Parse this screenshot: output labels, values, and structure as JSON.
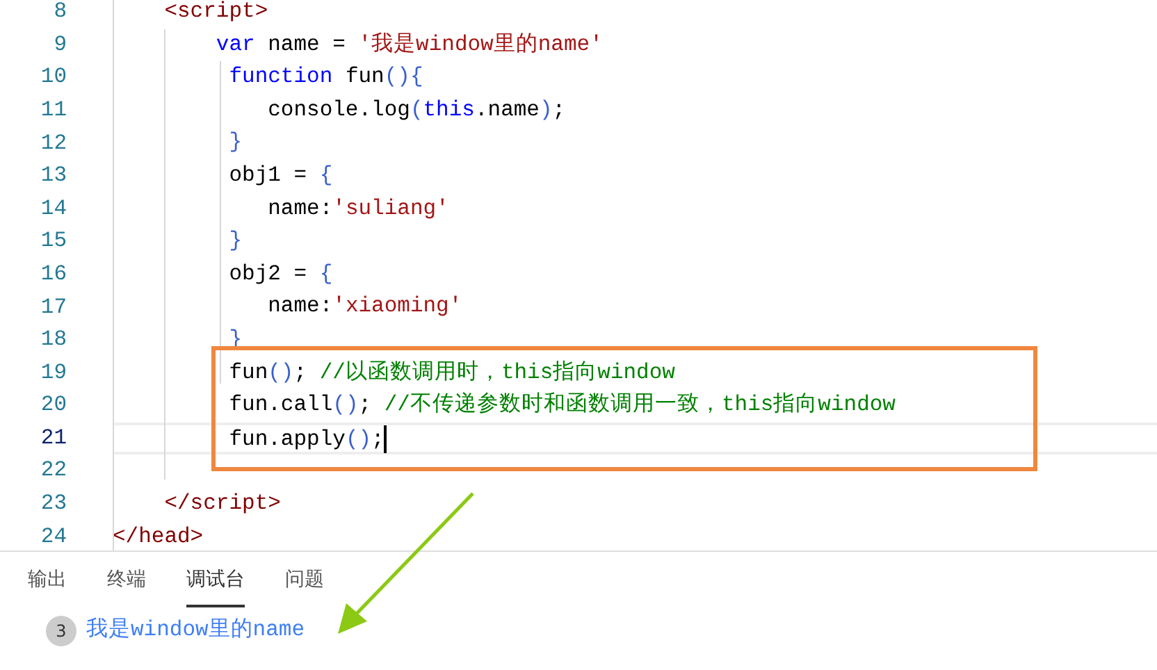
{
  "editor": {
    "lines": [
      {
        "number": "8",
        "current": false,
        "boxed": false,
        "tokens": [
          {
            "kind": "tag",
            "text": "    <script>"
          }
        ]
      },
      {
        "number": "9",
        "current": false,
        "boxed": false,
        "tokens": [
          {
            "kind": "keyword",
            "text": "        var"
          },
          {
            "kind": "plain",
            "text": " name = "
          },
          {
            "kind": "string",
            "text": "'我是window里的name'"
          }
        ]
      },
      {
        "number": "10",
        "current": false,
        "boxed": false,
        "tokens": [
          {
            "kind": "keyword",
            "text": "         function"
          },
          {
            "kind": "plain",
            "text": " fun"
          },
          {
            "kind": "bracket",
            "text": "(){"
          }
        ]
      },
      {
        "number": "11",
        "current": false,
        "boxed": false,
        "tokens": [
          {
            "kind": "plain",
            "text": "            console.log"
          },
          {
            "kind": "bracket",
            "text": "("
          },
          {
            "kind": "keyword",
            "text": "this"
          },
          {
            "kind": "plain",
            "text": ".name"
          },
          {
            "kind": "bracket",
            "text": ")"
          },
          {
            "kind": "plain",
            "text": ";"
          }
        ]
      },
      {
        "number": "12",
        "current": false,
        "boxed": false,
        "tokens": [
          {
            "kind": "bracket",
            "text": "         }"
          }
        ]
      },
      {
        "number": "13",
        "current": false,
        "boxed": false,
        "tokens": [
          {
            "kind": "plain",
            "text": "         obj1 = "
          },
          {
            "kind": "bracket",
            "text": "{"
          }
        ]
      },
      {
        "number": "14",
        "current": false,
        "boxed": false,
        "tokens": [
          {
            "kind": "plain",
            "text": "            name:"
          },
          {
            "kind": "string",
            "text": "'suliang'"
          }
        ]
      },
      {
        "number": "15",
        "current": false,
        "boxed": false,
        "tokens": [
          {
            "kind": "bracket",
            "text": "         }"
          }
        ]
      },
      {
        "number": "16",
        "current": false,
        "boxed": false,
        "tokens": [
          {
            "kind": "plain",
            "text": "         obj2 = "
          },
          {
            "kind": "bracket",
            "text": "{"
          }
        ]
      },
      {
        "number": "17",
        "current": false,
        "boxed": false,
        "tokens": [
          {
            "kind": "plain",
            "text": "            name:"
          },
          {
            "kind": "string",
            "text": "'xiaoming'"
          }
        ]
      },
      {
        "number": "18",
        "current": false,
        "boxed": false,
        "tokens": [
          {
            "kind": "bracket",
            "text": "         }"
          }
        ]
      },
      {
        "number": "19",
        "current": false,
        "boxed": true,
        "tokens": [
          {
            "kind": "plain",
            "text": "         fun"
          },
          {
            "kind": "bracket",
            "text": "()"
          },
          {
            "kind": "plain",
            "text": "; "
          },
          {
            "kind": "comment",
            "text": "//以函数调用时，this指向window"
          }
        ]
      },
      {
        "number": "20",
        "current": false,
        "boxed": true,
        "tokens": [
          {
            "kind": "plain",
            "text": "         fun.call"
          },
          {
            "kind": "bracket",
            "text": "()"
          },
          {
            "kind": "plain",
            "text": "; "
          },
          {
            "kind": "comment",
            "text": "//不传递参数时和函数调用一致，this指向window"
          }
        ]
      },
      {
        "number": "21",
        "current": true,
        "boxed": true,
        "tokens": [
          {
            "kind": "plain",
            "text": "         fun.apply"
          },
          {
            "kind": "bracket",
            "text": "()"
          },
          {
            "kind": "plain",
            "text": ";"
          }
        ]
      },
      {
        "number": "22",
        "current": false,
        "boxed": false
      },
      {
        "number": "23",
        "current": false,
        "boxed": false,
        "tokens": [
          {
            "kind": "tag",
            "text": "    </script>"
          }
        ]
      },
      {
        "number": "24",
        "current": false,
        "boxed": false,
        "tokens": [
          {
            "kind": "tag",
            "text": "</head>"
          }
        ]
      }
    ]
  },
  "panel": {
    "tabs": [
      {
        "label": "输出",
        "selected": false
      },
      {
        "label": "终端",
        "selected": false
      },
      {
        "label": "调试台",
        "selected": true
      },
      {
        "label": "问题",
        "selected": false
      }
    ],
    "console": [
      {
        "count": "3",
        "message": "我是window里的name"
      }
    ]
  }
}
